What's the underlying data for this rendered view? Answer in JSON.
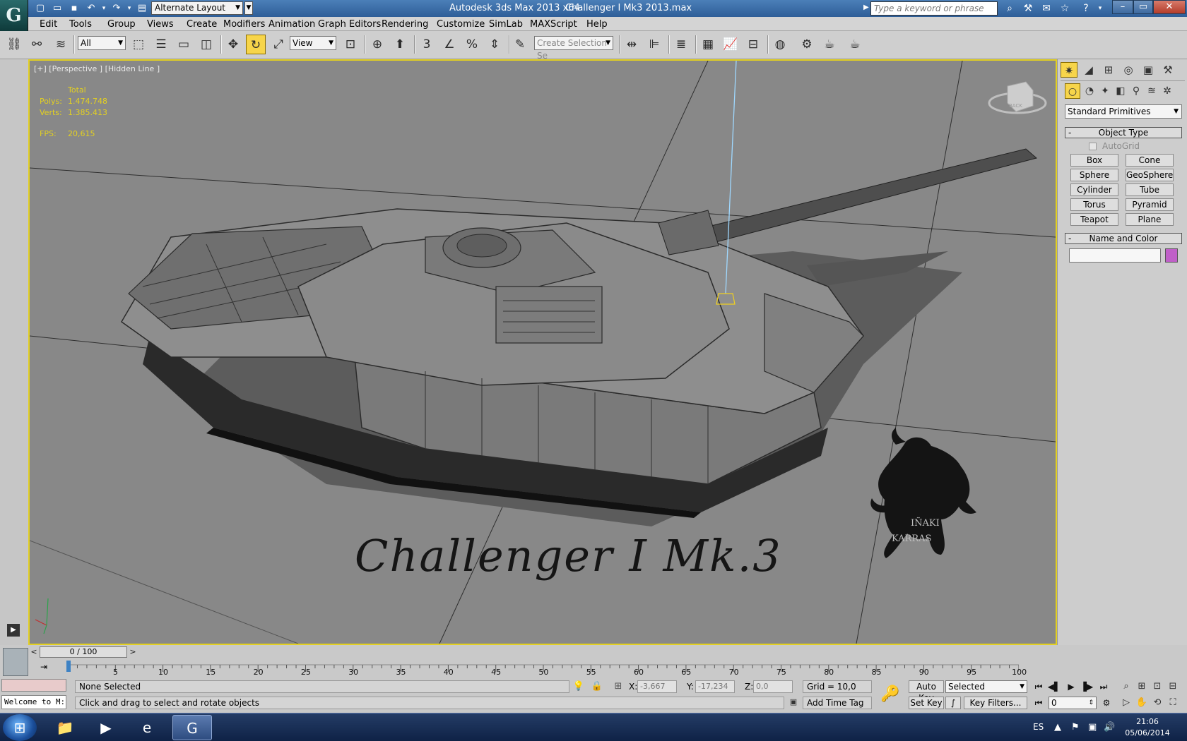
{
  "window": {
    "app_title": "Autodesk 3ds Max  2013 x64",
    "file_title": "Challenger I Mk3 2013.max",
    "workspace_layout": "Alternate Layout",
    "search_placeholder": "Type a keyword or phrase",
    "logo_glyph": "G",
    "controls": [
      "–",
      "▭",
      "✕"
    ]
  },
  "menu": [
    "Edit",
    "Tools",
    "Group",
    "Views",
    "Create",
    "Modifiers",
    "Animation",
    "Graph Editors",
    "Rendering",
    "Customize",
    "SimLab",
    "MAXScript",
    "Help"
  ],
  "toolbar": {
    "selection_filter": "All",
    "ref_coord_system": "View",
    "named_selection_placeholder": "Create Selection Se",
    "snap_label": "3",
    "active_tool": "select-rotate"
  },
  "viewport": {
    "label": "[+] [Perspective ] [Hidden Line ]",
    "stats": {
      "header": "Total",
      "polys_label": "Polys:",
      "polys": "1.474.748",
      "verts_label": "Verts:",
      "verts": "1.385.413",
      "fps_label": "FPS:",
      "fps": "20,615"
    },
    "model_title": "Challenger I Mk.3",
    "brand_line1": "IÑAKI",
    "brand_line2": "KARRAS",
    "viewcube_face": "BACK",
    "border_color": "#e3d021"
  },
  "command_panel": {
    "category": "Standard Primitives",
    "object_type_title": "Object Type",
    "autogrid_label": "AutoGrid",
    "primitives": [
      "Box",
      "Cone",
      "Sphere",
      "GeoSphere",
      "Cylinder",
      "Tube",
      "Torus",
      "Pyramid",
      "Teapot",
      "Plane"
    ],
    "name_color_title": "Name and Color",
    "object_color": "#c060c8"
  },
  "timeline": {
    "frame_display": "0 / 100",
    "prev_glyph": "<",
    "next_glyph": ">",
    "ticks": [
      "5",
      "10",
      "15",
      "20",
      "25",
      "30",
      "35",
      "40",
      "45",
      "50",
      "55",
      "60",
      "65",
      "70",
      "75",
      "80",
      "85",
      "90",
      "95",
      "100"
    ]
  },
  "status": {
    "welcome": "Welcome to M:",
    "selection": "None Selected",
    "prompt": "Click and drag to select and rotate objects",
    "x_label": "X:",
    "x": "-3,667",
    "y_label": "Y:",
    "y": "-17,234",
    "z_label": "Z:",
    "z": "0,0",
    "grid": "Grid = 10,0",
    "add_time_tag": "Add Time Tag",
    "auto_key": "Auto Key",
    "set_key": "Set Key",
    "key_mode": "Selected",
    "key_filters": "Key Filters...",
    "current_frame": "0"
  },
  "taskbar": {
    "language": "ES",
    "time": "21:06",
    "date": "05/06/2014"
  }
}
